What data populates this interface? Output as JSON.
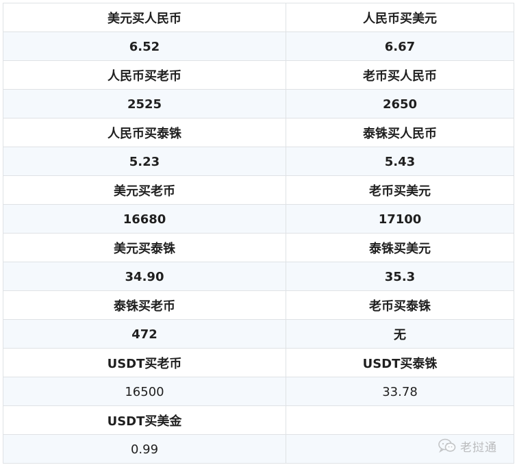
{
  "rows": [
    {
      "left": "美元买人民币",
      "right": "人民币买美元"
    },
    {
      "left": "6.52",
      "right": "6.67"
    },
    {
      "left": "人民币买老币",
      "right": "老币买人民币"
    },
    {
      "left": "2525",
      "right": "2650"
    },
    {
      "left": "人民币买泰铢",
      "right": "泰铢买人民币"
    },
    {
      "left": "5.23",
      "right": "5.43"
    },
    {
      "left": "美元买老币",
      "right": "老币买美元"
    },
    {
      "left": "16680",
      "right": "17100"
    },
    {
      "left": "美元买泰铢",
      "right": "泰铢买美元"
    },
    {
      "left": "34.90",
      "right": "35.3"
    },
    {
      "left": "泰铢买老币",
      "right": "老币买泰铢"
    },
    {
      "left": "472",
      "right": "无"
    },
    {
      "left": "USDT买老币",
      "right": "USDT买泰铢"
    },
    {
      "left": "16500",
      "right": "33.78"
    },
    {
      "left": "USDT买美金",
      "right": ""
    },
    {
      "left": "0.99",
      "right": ""
    }
  ],
  "watermark": {
    "icon": "wechat-icon",
    "text": "老挝通"
  }
}
